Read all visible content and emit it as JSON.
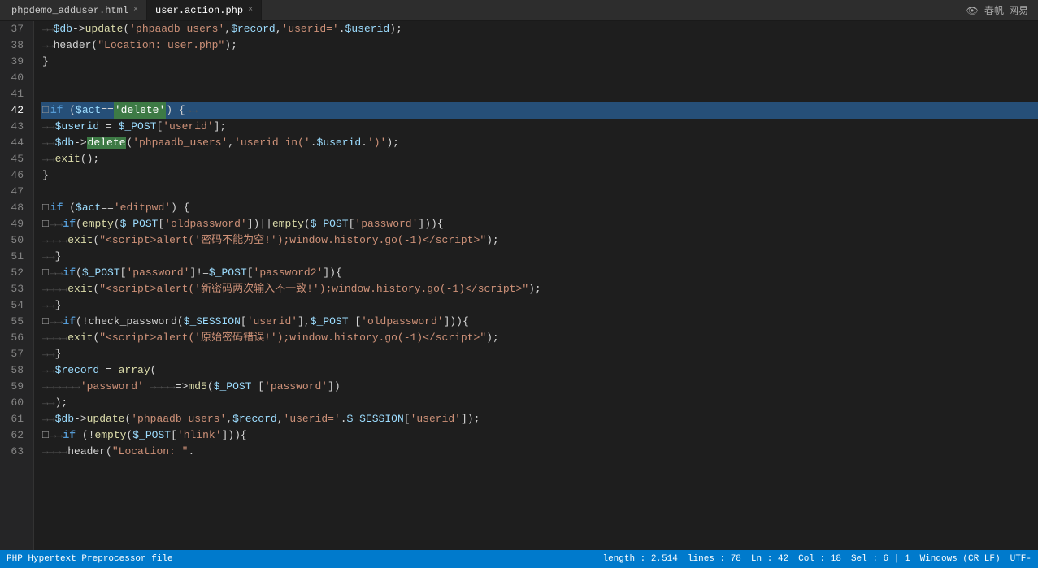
{
  "tabs": [
    {
      "id": "tab1",
      "label": "phpdemo_adduser.html",
      "active": false,
      "close": "×"
    },
    {
      "id": "tab2",
      "label": "user.action.php",
      "active": true,
      "close": "×"
    }
  ],
  "top_right": {
    "logo1": "👁 春帆",
    "logo2": "网易"
  },
  "lines": [
    {
      "num": "37",
      "content_html": "<span class='tab-arrow'>→→</span><span class='var'>$db</span><span class='op'>-&gt;</span><span class='fn'>update</span><span class='op'>(</span><span class='str'>'phpaadb_users'</span><span class='op'>,</span><span class='var'>$record</span><span class='op'>,</span><span class='str'>'userid='</span><span class='op'>.</span><span class='var'>$userid</span><span class='op'>);</span>"
    },
    {
      "num": "38",
      "content_html": "<span class='tab-arrow'>→→</span><span class='kw'>header</span><span class='op'>(</span><span class='str'>\"Location: user.php\"</span><span class='op'>);</span>"
    },
    {
      "num": "39",
      "content_html": "<span class='brace'>}</span>"
    },
    {
      "num": "40",
      "content_html": ""
    },
    {
      "num": "41",
      "content_html": ""
    },
    {
      "num": "42",
      "content_html": "<span class='kw-bold'>if</span> <span class='op'>(</span><span class='var'>$act</span><span class='op'>==</span><span class='highlight-delete'>'delete'</span><span class='op'>)</span> <span class='op'>{</span><span class='tab-arrow'>→→</span>",
      "active": true
    },
    {
      "num": "43",
      "content_html": "<span class='tab-arrow'>→→</span><span class='var'>$userid</span> <span class='op'>=</span> <span class='var'>$_POST</span><span class='op'>[</span><span class='str'>'userid'</span><span class='op'>];</span>"
    },
    {
      "num": "44",
      "content_html": "<span class='tab-arrow'>→→</span><span class='var'>$db</span><span class='op'>-&gt;</span><span class='highlight-delete'>delete</span><span class='op'>(</span><span class='str'>'phpaadb_users'</span><span class='op'>,</span><span class='str'>'userid in('</span><span class='op'>.</span><span class='var'>$userid</span><span class='op'>.</span><span class='str'>')'</span><span class='op'>);</span>"
    },
    {
      "num": "45",
      "content_html": "<span class='tab-arrow'>→→</span><span class='fn'>exit</span><span class='op'>();</span>"
    },
    {
      "num": "46",
      "content_html": "<span class='brace'>}</span>"
    },
    {
      "num": "47",
      "content_html": ""
    },
    {
      "num": "48",
      "content_html": "<span class='fold-icon'>□</span><span class='kw-bold'>if</span> <span class='op'>(</span><span class='var'>$act</span><span class='op'>==</span><span class='str'>'editpwd'</span><span class='op'>)</span> <span class='op'>{</span>"
    },
    {
      "num": "49",
      "content_html": "<span class='fold-icon'>□</span><span class='tab-arrow'>→→</span><span class='kw-bold'>if</span><span class='op'>(</span><span class='fn'>empty</span><span class='op'>(</span><span class='var'>$_POST</span><span class='op'>[</span><span class='str'>'oldpassword'</span><span class='op'>]</span><span class='op'>)</span><span class='op'>||</span><span class='fn'>empty</span><span class='op'>(</span><span class='var'>$_POST</span><span class='op'>[</span><span class='str'>'password'</span><span class='op'>]</span><span class='op'>))</span><span class='op'>{</span>"
    },
    {
      "num": "50",
      "content_html": "<span class='tab-arrow'>→→→→</span><span class='fn'>exit</span><span class='op'>(</span><span class='str'>\"&lt;script&gt;alert('密码不能为空!');window.history.go(-1)&lt;/script&gt;\"</span><span class='op'>);</span>"
    },
    {
      "num": "51",
      "content_html": "<span class='tab-arrow'>→→</span><span class='brace'>}</span>"
    },
    {
      "num": "52",
      "content_html": "<span class='fold-icon'>□</span><span class='tab-arrow'>→→</span><span class='kw-bold'>if</span><span class='op'>(</span><span class='var'>$_POST</span><span class='op'>[</span><span class='str'>'password'</span><span class='op'>]</span><span class='op'>!=</span><span class='var'>$_POST</span><span class='op'>[</span><span class='str'>'password2'</span><span class='op'>]</span><span class='op'>){</span>"
    },
    {
      "num": "53",
      "content_html": "<span class='tab-arrow'>→→→→</span><span class='fn'>exit</span><span class='op'>(</span><span class='str'>\"&lt;script&gt;alert('新密码两次输入不一致!');window.history.go(-1)&lt;/script&gt;\"</span><span class='op'>);</span>"
    },
    {
      "num": "54",
      "content_html": "<span class='tab-arrow'>→→</span><span class='brace'>}</span>"
    },
    {
      "num": "55",
      "content_html": "<span class='fold-icon'>□</span><span class='tab-arrow'>→→</span><span class='kw-bold'>if</span><span class='op'>(!</span><span class='fn'>check_password</span><span class='op'>(</span><span class='var'>$_SESSION</span><span class='op'>[</span><span class='str'>'userid'</span><span class='op'>]</span><span class='op'>,</span><span class='var'>$_POST</span> <span class='op'>[</span><span class='str'>'oldpassword'</span><span class='op'>]</span><span class='op'>)){</span>"
    },
    {
      "num": "56",
      "content_html": "<span class='tab-arrow'>→→→→</span><span class='fn'>exit</span><span class='op'>(</span><span class='str'>\"&lt;script&gt;alert('原始密码错误!');window.history.go(-1)&lt;/script&gt;\"</span><span class='op'>);</span>"
    },
    {
      "num": "57",
      "content_html": "<span class='tab-arrow'>→→</span><span class='brace'>}</span>"
    },
    {
      "num": "58",
      "content_html": "<span class='tab-arrow'>→→</span><span class='var'>$record</span> <span class='op'>=</span> <span class='fn'>array</span><span class='op'>(</span>"
    },
    {
      "num": "59",
      "content_html": "<span class='tab-arrow'>→→→→→→</span><span class='str'>'password'</span> <span class='arrow'>→→→→</span><span class='op'>=&gt;</span><span class='fn'>md5</span><span class='op'>(</span><span class='var'>$_POST</span> <span class='op'>[</span><span class='str'>'password'</span><span class='op'>]</span><span class='op'>)</span>"
    },
    {
      "num": "60",
      "content_html": "<span class='tab-arrow'>→→</span><span class='op'>);</span>"
    },
    {
      "num": "61",
      "content_html": "<span class='tab-arrow'>→→</span><span class='var'>$db</span><span class='op'>-&gt;</span><span class='fn'>update</span><span class='op'>(</span><span class='str'>'phpaadb_users'</span><span class='op'>,</span><span class='var'>$record</span><span class='op'>,</span><span class='str'>'userid='</span><span class='op'>.</span><span class='var'>$_SESSION</span><span class='op'>[</span><span class='str'>'userid'</span><span class='op'>]</span><span class='op'>);</span>"
    },
    {
      "num": "62",
      "content_html": "<span class='fold-icon'>□</span><span class='tab-arrow'>→→</span><span class='kw-bold'>if</span> <span class='op'>(!</span><span class='fn'>empty</span><span class='op'>(</span><span class='var'>$_POST</span><span class='op'>[</span><span class='str'>'hlink'</span><span class='op'>]</span><span class='op'>)){</span>"
    },
    {
      "num": "63",
      "content_html": "<span class='tab-arrow'>→→→→</span><span class='kw'>header</span><span class='op'>(</span><span class='str'>\"Location: \"</span><span class='op'>.</span>"
    }
  ],
  "status": {
    "file_type": "PHP Hypertext Preprocessor file",
    "length": "length : 2,514",
    "lines": "lines : 78",
    "ln": "Ln : 42",
    "col": "Col : 18",
    "sel": "Sel : 6 | 1",
    "encoding": "Windows (CR LF)",
    "utf": "UTF-"
  }
}
